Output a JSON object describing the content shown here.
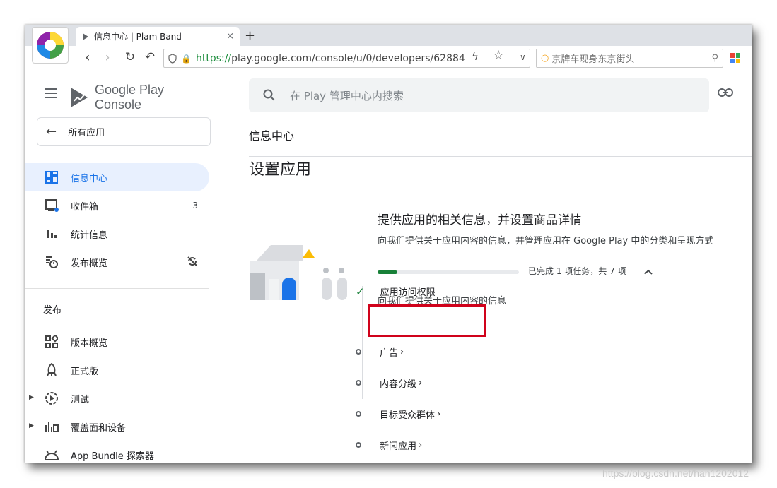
{
  "browser": {
    "tab_title": "信息中心 | Plam Band",
    "tab_close": "×",
    "new_tab": "+",
    "url_protocol": "https://",
    "url_rest": "play.google.com/console/u/0/developers/62884",
    "search_placeholder": "京牌车现身东京街头"
  },
  "brand": {
    "google_play": "Google Play",
    "console": "Console"
  },
  "sidebar": {
    "all_apps": "所有应用",
    "items": [
      {
        "label": "信息中心",
        "icon": "dashboard-icon",
        "active": true
      },
      {
        "label": "收件箱",
        "icon": "inbox-icon",
        "badge": "3"
      },
      {
        "label": "统计信息",
        "icon": "bar-chart-icon"
      },
      {
        "label": "发布概览",
        "icon": "publishing-overview-icon"
      }
    ],
    "section_release": "发布",
    "release_items": [
      {
        "label": "版本概览",
        "icon": "release-overview-icon"
      },
      {
        "label": "正式版",
        "icon": "production-icon"
      },
      {
        "label": "测试",
        "icon": "testing-icon"
      },
      {
        "label": "覆盖面和设备",
        "icon": "reach-devices-icon"
      },
      {
        "label": "App Bundle 探索器",
        "icon": "app-bundle-icon"
      }
    ]
  },
  "main": {
    "search_placeholder": "在 Play 管理中心内搜索",
    "breadcrumb": "信息中心",
    "page_title": "设置应用",
    "card": {
      "title": "提供应用的相关信息，并设置商品详情",
      "description": "向我们提供关于应用内容的信息，并管理应用在 Google Play 中的分类和呈现方式",
      "progress_fraction": 0.14,
      "progress_text": "已完成 1 项任务，共 7 项",
      "group_label": "向我们提供关于应用内容的信息",
      "tasks": [
        {
          "label": "应用访问权限",
          "done": true
        },
        {
          "label": "广告",
          "done": false
        },
        {
          "label": "内容分级",
          "done": false
        },
        {
          "label": "目标受众群体",
          "done": false
        },
        {
          "label": "新闻应用",
          "done": false
        }
      ]
    }
  },
  "watermark": "https://blog.csdn.net/han1202012",
  "colors": {
    "accent_blue": "#1a73e8",
    "success_green": "#188038",
    "highlight_red": "#d0021b"
  }
}
